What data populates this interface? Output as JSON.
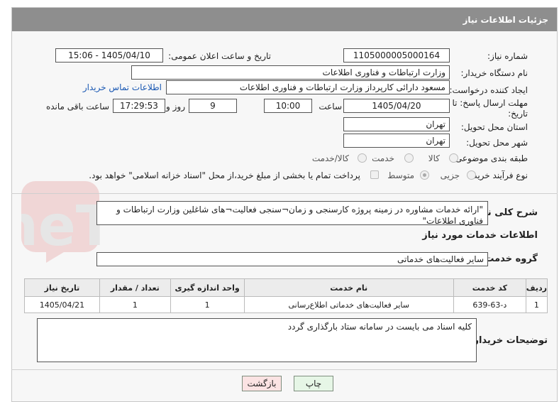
{
  "header": {
    "title": "جزئیات اطلاعات نیاز"
  },
  "fields": {
    "need_number_label": "شماره نیاز:",
    "need_number": "1105000005000164",
    "announce_label": "تاریخ و ساعت اعلان عمومی:",
    "announce_value": "1405/04/10 - 15:06",
    "buyer_org_label": "نام دستگاه خریدار:",
    "buyer_org": "وزارت ارتباطات و فناوری اطلاعات",
    "creator_label": "ایجاد کننده درخواست:",
    "creator": "مسعود دارائی کارپرداز وزارت ارتباطات و فناوری اطلاعات",
    "contact_link": "اطلاعات تماس خریدار",
    "deadline_label": "مهلت ارسال پاسخ: تا تاریخ:",
    "deadline_date": "1405/04/20",
    "time_label": "ساعت",
    "deadline_time": "10:00",
    "days_value": "9",
    "days_label": "روز و",
    "remaining_time": "17:29:53",
    "remaining_label": "ساعت باقی مانده",
    "province_label": "استان محل تحویل:",
    "province": "تهران",
    "city_label": "شهر محل تحویل:",
    "city": "تهران",
    "category_label": "طبقه بندی موضوعی:",
    "category_options": [
      "کالا",
      "خدمت",
      "کالا/خدمت"
    ],
    "process_label": "نوع فرآیند خرید :",
    "process_options": [
      "جزیی",
      "متوسط"
    ],
    "payment_note": "پرداخت تمام یا بخشی از مبلغ خرید،از محل \"اسناد خزانه اسلامی\" خواهد بود."
  },
  "summary": {
    "label": "شرح کلی نیاز:",
    "text": "\"ارائه خدمات مشاوره در زمینه پروژه کارسنجی و زمان¬سنجی فعالیت¬های شاغلین وزارت ارتباطات و فناوری اطلاعات\""
  },
  "services": {
    "section_title": "اطلاعات خدمات مورد نیاز",
    "group_label": "گروه خدمت:",
    "group_value": "سایر فعالیت‌های خدماتی",
    "columns": [
      "ردیف",
      "کد خدمت",
      "نام خدمت",
      "واحد اندازه گیری",
      "تعداد / مقدار",
      "تاریخ نیاز"
    ],
    "rows": [
      [
        "1",
        "د-63-639",
        "سایر فعالیت‌های خدماتی اطلاع‌رسانی",
        "1",
        "1",
        "1405/04/21"
      ]
    ]
  },
  "buyer_notes": {
    "label": "توضیحات خریدار:",
    "text": "کلیه اسناد می بایست در سامانه ستاد بارگذاری گردد"
  },
  "actions": {
    "print": "چاپ",
    "back": "بازگشت"
  },
  "colors": {
    "header_bg": "#8e8e8e",
    "link": "#1a58b3",
    "print_bg": "#e6f6e6",
    "back_bg": "#fbe3e3"
  },
  "watermark": {
    "text": "AriaTender.neT"
  }
}
